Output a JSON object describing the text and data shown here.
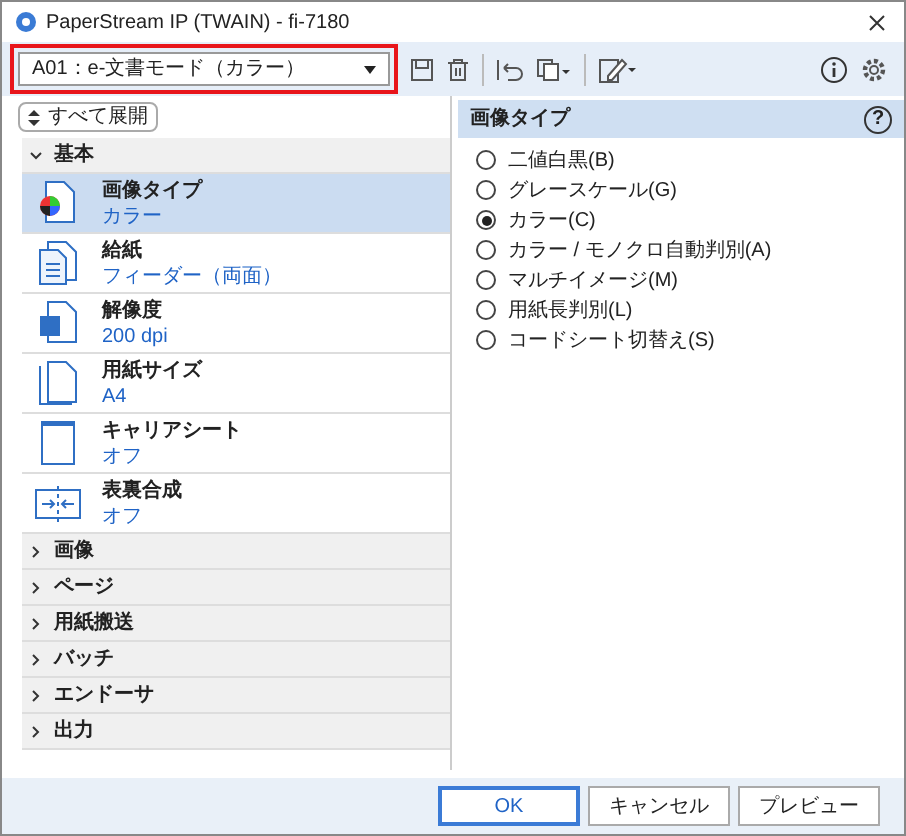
{
  "window": {
    "title": "PaperStream IP (TWAIN) - fi-7180"
  },
  "profile": {
    "value": "A01：e-文書モード（カラー）"
  },
  "expand_all": "すべて展開",
  "groups": [
    {
      "label": "基本",
      "expanded": true,
      "items": [
        {
          "label": "画像タイプ",
          "value": "カラー",
          "selected": true
        },
        {
          "label": "給紙",
          "value": "フィーダー（両面）",
          "selected": false
        },
        {
          "label": "解像度",
          "value": "200 dpi",
          "selected": false
        },
        {
          "label": "用紙サイズ",
          "value": "A4",
          "selected": false
        },
        {
          "label": "キャリアシート",
          "value": "オフ",
          "selected": false
        },
        {
          "label": "表裏合成",
          "value": "オフ",
          "selected": false
        }
      ]
    },
    {
      "label": "画像",
      "expanded": false
    },
    {
      "label": "ページ",
      "expanded": false
    },
    {
      "label": "用紙搬送",
      "expanded": false
    },
    {
      "label": "バッチ",
      "expanded": false
    },
    {
      "label": "エンドーサ",
      "expanded": false
    },
    {
      "label": "出力",
      "expanded": false
    }
  ],
  "panel": {
    "title": "画像タイプ",
    "help": "?",
    "options": [
      {
        "label": "二値白黒(B)",
        "selected": false
      },
      {
        "label": "グレースケール(G)",
        "selected": false
      },
      {
        "label": "カラー(C)",
        "selected": true
      },
      {
        "label": "カラー / モノクロ自動判別(A)",
        "selected": false
      },
      {
        "label": "マルチイメージ(M)",
        "selected": false
      },
      {
        "label": "用紙長判別(L)",
        "selected": false
      },
      {
        "label": "コードシート切替え(S)",
        "selected": false
      }
    ]
  },
  "buttons": [
    {
      "label": "OK",
      "default": true
    },
    {
      "label": "キャンセル",
      "default": false
    },
    {
      "label": "プレビュー",
      "default": false
    }
  ]
}
